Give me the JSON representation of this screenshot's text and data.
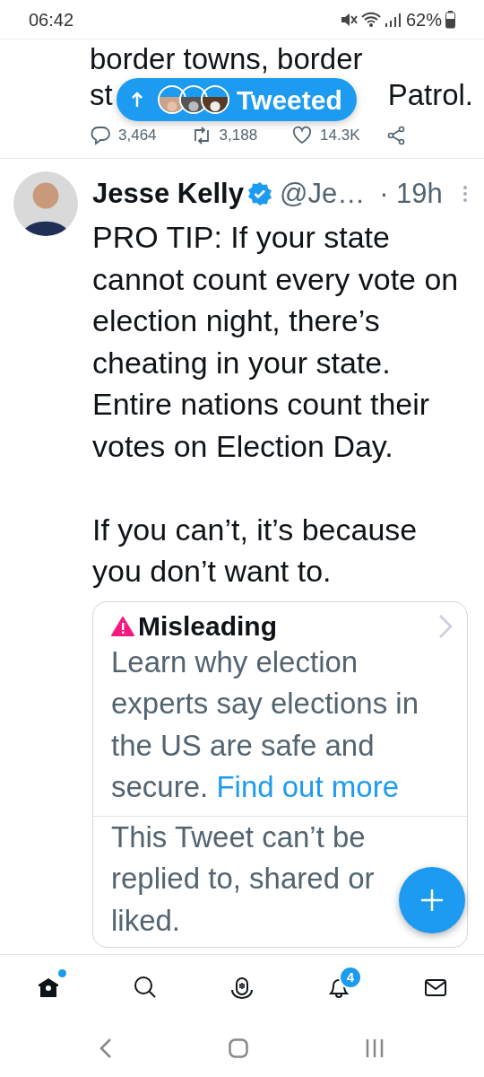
{
  "status_bar": {
    "time": "06:42",
    "battery": "62%",
    "muted": true
  },
  "tweeted_pill": {
    "label": "Tweeted"
  },
  "previous_tweet": {
    "first_line": "border towns, border",
    "fragments": [
      "st",
      "Patrol."
    ],
    "stats": {
      "replies": "3,464",
      "retweets": "3,188",
      "likes": "14.3K"
    }
  },
  "tweet": {
    "name": "Jesse Kelly",
    "verified": true,
    "handle": "@Je…",
    "time": "· 19h",
    "paragraphs": [
      "PRO TIP: If your state cannot count every vote on election night, there’s cheating in your state. Entire nations count their votes on Election Day.",
      "If you can’t, it’s because you don’t want to."
    ],
    "notice": {
      "label": "Misleading",
      "text": "Learn why election experts say elections in the US are safe and secure.",
      "link": "Find out more",
      "restriction": "This Tweet can’t be replied to, shared or liked."
    }
  },
  "nav": [
    {
      "kind": "home",
      "selected": true,
      "unread": true
    },
    {
      "kind": "search",
      "selected": false
    },
    {
      "kind": "spaces",
      "selected": false
    },
    {
      "kind": "notifications",
      "selected": false,
      "badge": "4"
    },
    {
      "kind": "messages",
      "selected": false
    }
  ]
}
